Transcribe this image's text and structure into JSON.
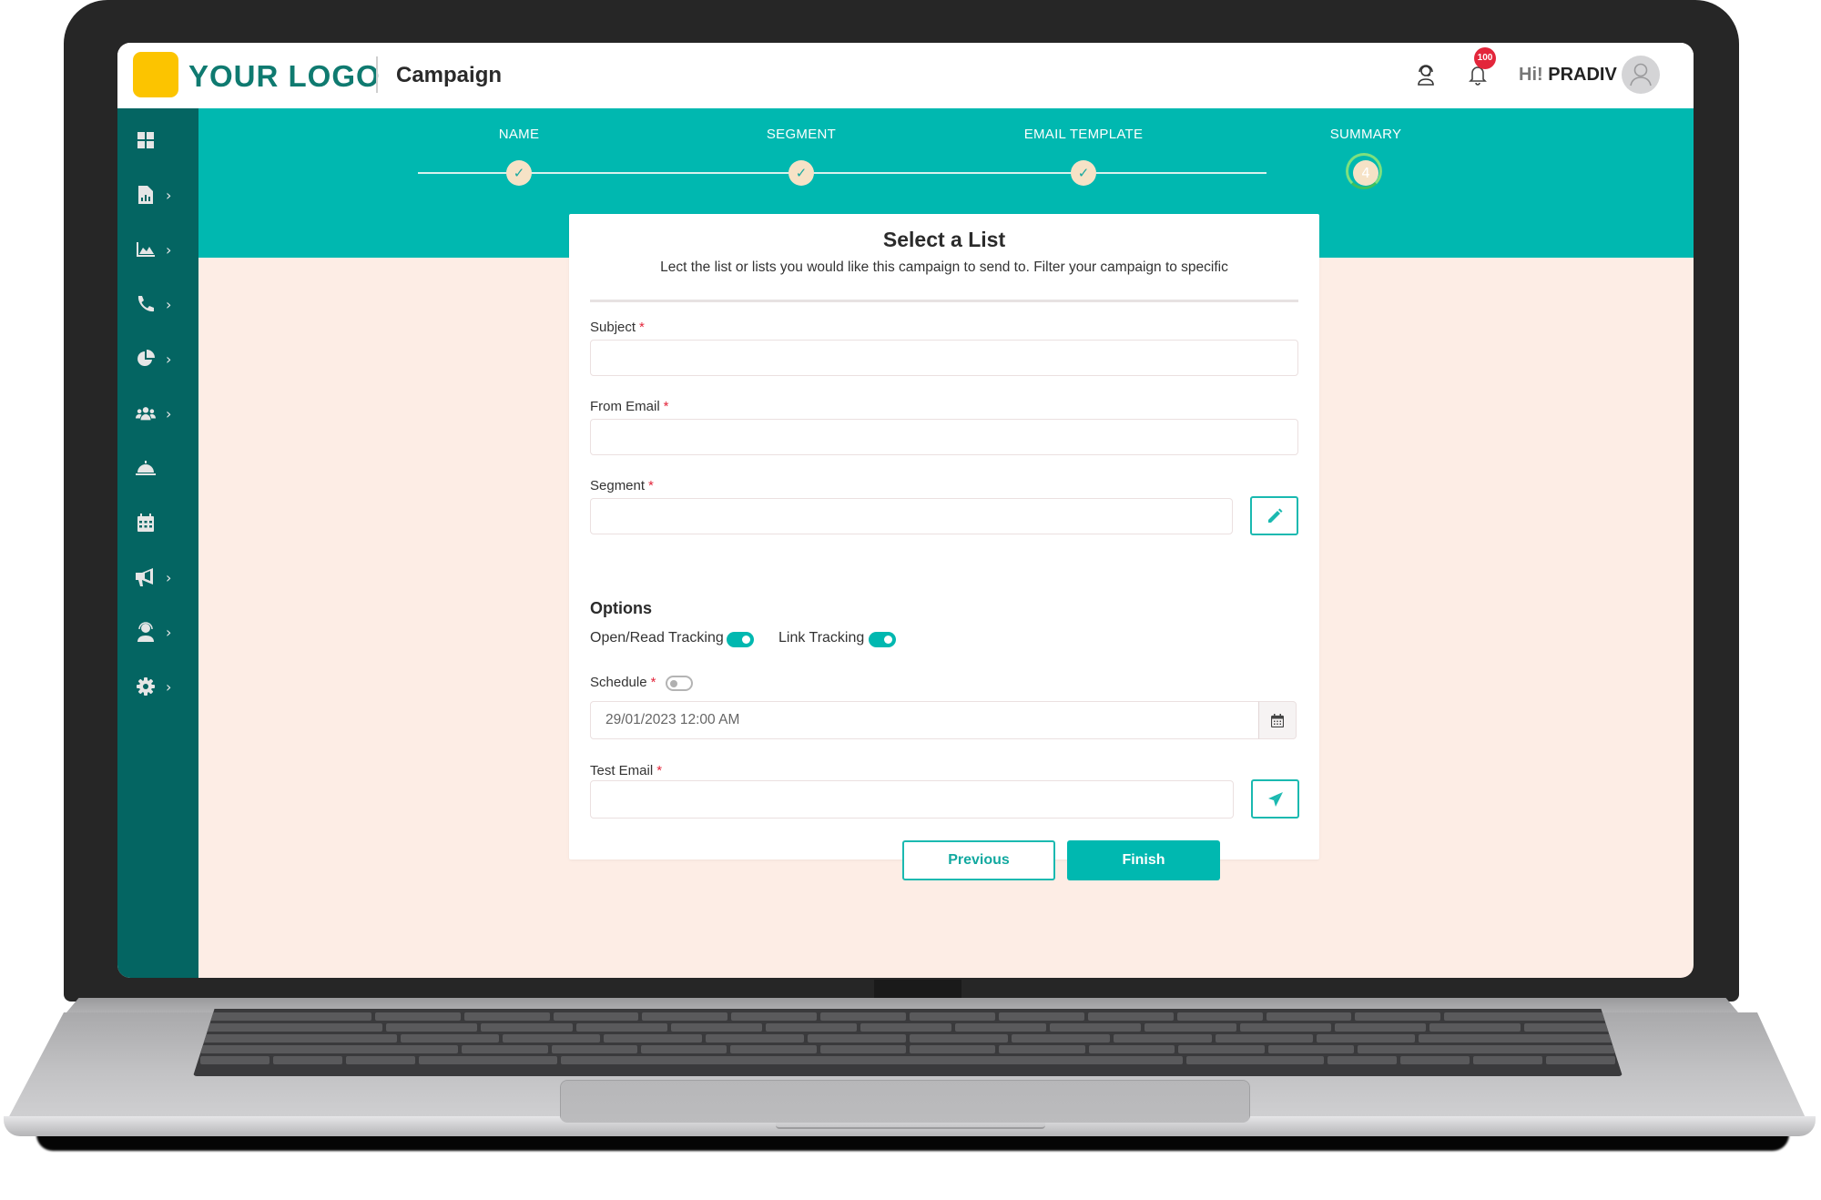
{
  "header": {
    "logo_text": "YOUR LOGO",
    "page_title": "Campaign",
    "notification_count": "100",
    "greeting_prefix": "Hi!",
    "user_name": "PRADIV",
    "icons": {
      "support": "headset-icon",
      "notifications": "bell-icon",
      "avatar": "user-icon"
    }
  },
  "sidebar": {
    "items": [
      {
        "icon": "dashboard-grid-icon",
        "has_submenu": false
      },
      {
        "icon": "report-file-icon",
        "has_submenu": true
      },
      {
        "icon": "area-chart-icon",
        "has_submenu": true
      },
      {
        "icon": "phone-icon",
        "has_submenu": true
      },
      {
        "icon": "pie-chart-icon",
        "has_submenu": true
      },
      {
        "icon": "users-icon",
        "has_submenu": true
      },
      {
        "icon": "service-bell-icon",
        "has_submenu": false
      },
      {
        "icon": "calendar-icon",
        "has_submenu": false
      },
      {
        "icon": "megaphone-icon",
        "has_submenu": true
      },
      {
        "icon": "support-agent-icon",
        "has_submenu": true
      },
      {
        "icon": "gear-icon",
        "has_submenu": true
      }
    ],
    "chevron": "›"
  },
  "stepper": {
    "steps": [
      {
        "label": "NAME",
        "status": "complete",
        "marker": "✓"
      },
      {
        "label": "SEGMENT",
        "status": "complete",
        "marker": "✓"
      },
      {
        "label": "EMAIL TEMPLATE",
        "status": "complete",
        "marker": "✓"
      },
      {
        "label": "SUMMARY",
        "status": "current",
        "marker": "4"
      }
    ]
  },
  "form": {
    "title": "Select a List",
    "subtitle": "Lect the list or lists you would like this campaign to send to. Filter your campaign to specific",
    "required_mark": "*",
    "subject": {
      "label": "Subject",
      "value": ""
    },
    "from_email": {
      "label": "From Email",
      "value": ""
    },
    "segment": {
      "label": "Segment",
      "value": ""
    },
    "options_title": "Options",
    "open_read_tracking": {
      "label": "Open/Read Tracking",
      "enabled": true
    },
    "link_tracking": {
      "label": "Link Tracking",
      "enabled": true
    },
    "schedule": {
      "label": "Schedule",
      "enabled": false,
      "value": "29/01/2023 12:00 AM"
    },
    "test_email": {
      "label": "Test Email",
      "value": ""
    },
    "previous_label": "Previous",
    "finish_label": "Finish"
  },
  "colors": {
    "primary": "#00b8b0",
    "sidebar": "#046562",
    "logo_mark": "#fcc400",
    "logo_text": "#0f7a70",
    "page_background": "#fdede5",
    "badge": "#e3263b"
  }
}
